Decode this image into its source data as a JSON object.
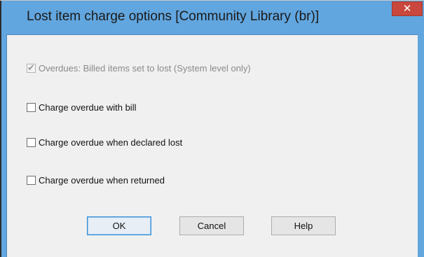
{
  "window": {
    "title": "Lost item charge options [Community Library  (br)]",
    "close_glyph": "✕"
  },
  "options": [
    {
      "label": "Overdues: Billed items set to lost (System level only)",
      "checked": true,
      "disabled": true
    },
    {
      "label": "Charge overdue with bill",
      "checked": false,
      "disabled": false
    },
    {
      "label": "Charge overdue when declared lost",
      "checked": false,
      "disabled": false
    },
    {
      "label": "Charge overdue when returned",
      "checked": false,
      "disabled": false
    }
  ],
  "buttons": {
    "ok": "OK",
    "cancel": "Cancel",
    "help": "Help"
  },
  "colors": {
    "title_bar": "#62a6df",
    "close_button": "#c9473d",
    "client_bg": "#f0f0f0"
  }
}
